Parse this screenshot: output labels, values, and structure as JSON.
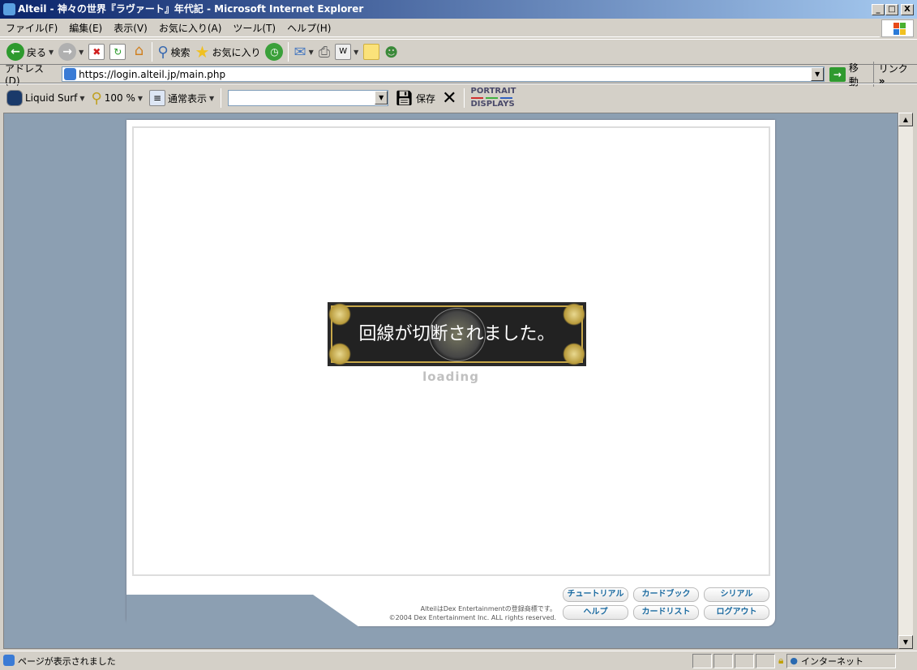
{
  "window": {
    "title": "Alteil - 神々の世界『ラヴァート』年代記 - Microsoft Internet Explorer",
    "minimize": "_",
    "maximize": "□",
    "close": "X"
  },
  "menu": [
    "ファイル(F)",
    "編集(E)",
    "表示(V)",
    "お気に入り(A)",
    "ツール(T)",
    "ヘルプ(H)"
  ],
  "toolbar": {
    "back": "戻る",
    "search": "検索",
    "favorites": "お気に入り"
  },
  "address": {
    "label": "アドレス(D)",
    "url": "https://login.alteil.jp/main.php",
    "go": "移動",
    "links": "リンク",
    "more": "»"
  },
  "toolbar2": {
    "liquid_surf": "Liquid Surf",
    "zoom": "100 %",
    "view_mode": "通常表示",
    "select_value": "",
    "save": "保存",
    "portrait_line1": "PORTRAIT",
    "portrait_line2": "DISPLAYS"
  },
  "page": {
    "dialog_message": "回線が切断されました。",
    "loading": "loading",
    "footer_buttons": [
      "チュートリアル",
      "カードブック",
      "シリアル",
      "ヘルプ",
      "カードリスト",
      "ログアウト"
    ],
    "trademark": "AlteilはDex Entertainmentの登録商標です。",
    "copyright": "©2004 Dex Entertainment Inc. ALL rights reserved."
  },
  "status": {
    "message": "ページが表示されました",
    "zone": "インターネット"
  }
}
